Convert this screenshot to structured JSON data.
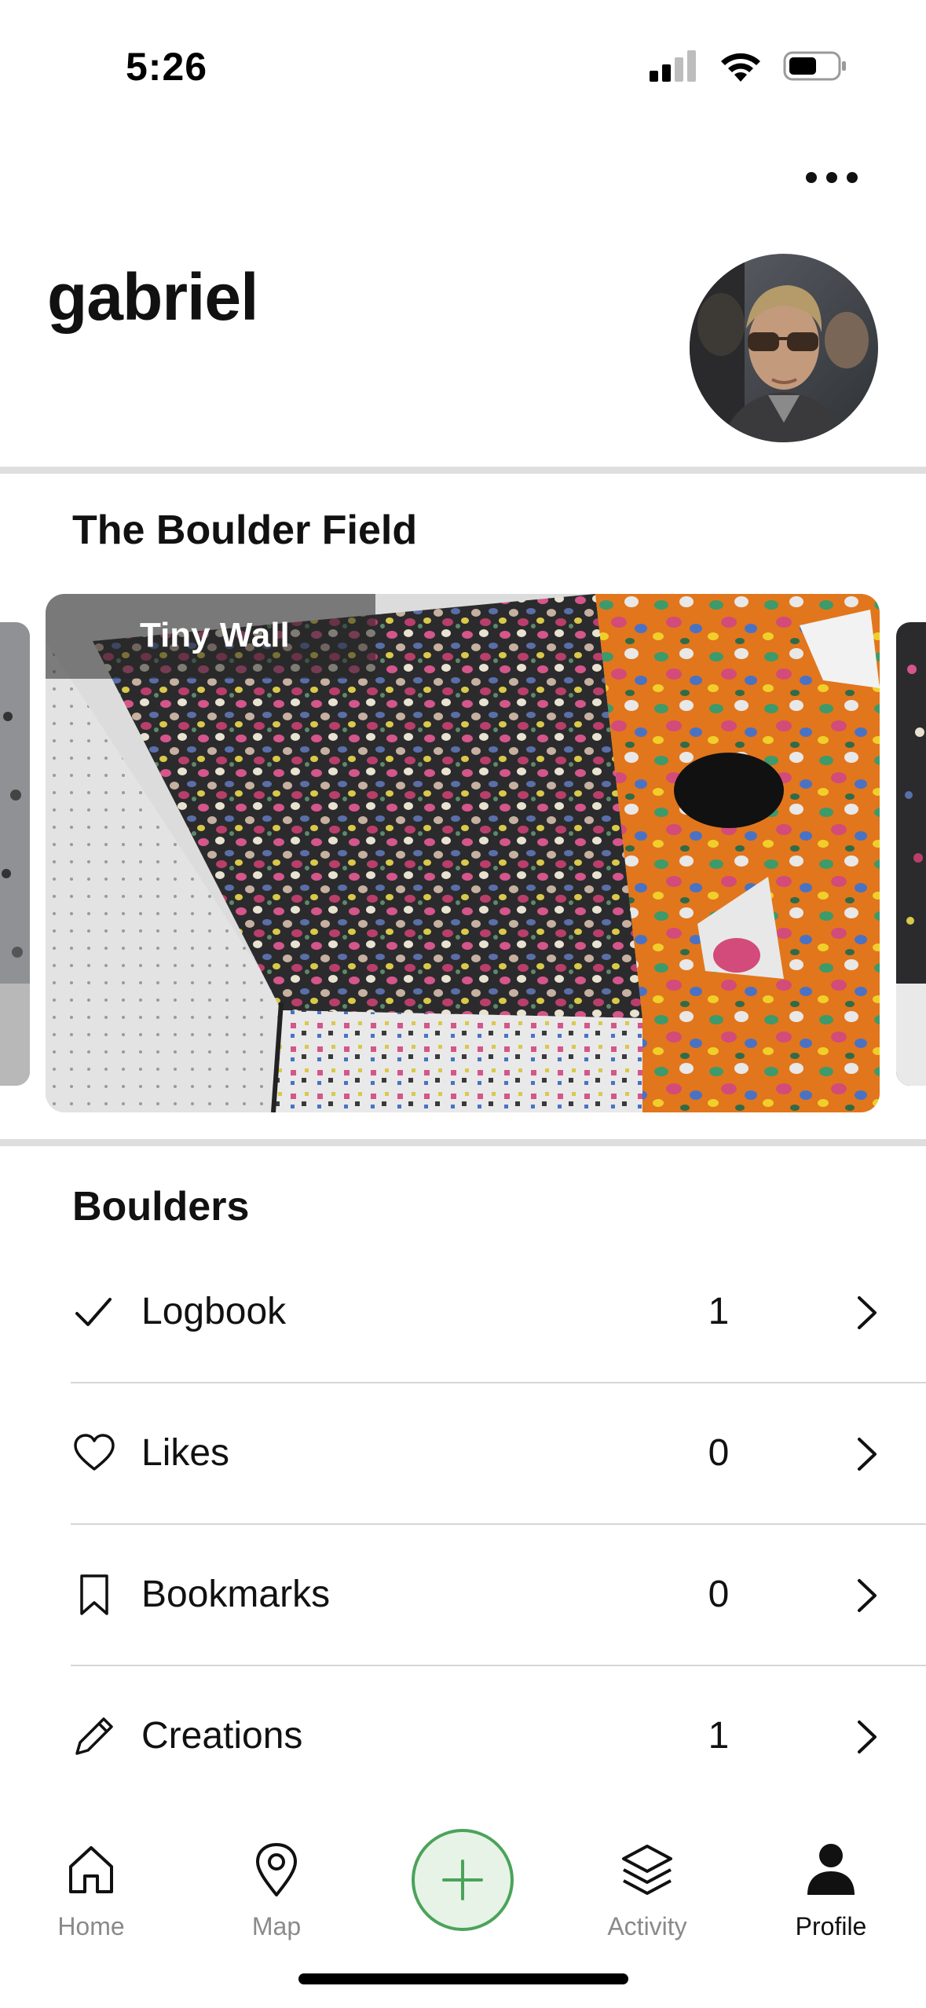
{
  "status_bar": {
    "time": "5:26",
    "icons": [
      "cellular-signal-icon",
      "wifi-icon",
      "battery-icon"
    ]
  },
  "header": {
    "username": "gabriel",
    "more_icon": "more-horizontal-icon"
  },
  "gym": {
    "name": "The Boulder Field",
    "walls": [
      {
        "label": "Tiny Wall"
      }
    ]
  },
  "boulders": {
    "title": "Boulders",
    "items": [
      {
        "label": "Logbook",
        "count": "1",
        "icon": "check-icon"
      },
      {
        "label": "Likes",
        "count": "0",
        "icon": "heart-icon"
      },
      {
        "label": "Bookmarks",
        "count": "0",
        "icon": "bookmark-icon"
      },
      {
        "label": "Creations",
        "count": "1",
        "icon": "pencil-icon"
      }
    ]
  },
  "tab_bar": {
    "items": [
      {
        "label": "Home",
        "icon": "home-icon",
        "active": false
      },
      {
        "label": "Map",
        "icon": "map-pin-icon",
        "active": false
      },
      {
        "label": "",
        "icon": "plus-icon",
        "active": false
      },
      {
        "label": "Activity",
        "icon": "layers-icon",
        "active": false
      },
      {
        "label": "Profile",
        "icon": "person-icon",
        "active": true
      }
    ]
  },
  "colors": {
    "accent_green": "#4ba35a",
    "add_button_fill": "#e6f3e6",
    "divider": "#dedede",
    "inactive_tab": "#8a8a8a",
    "wall_orange": "#e2761c"
  }
}
